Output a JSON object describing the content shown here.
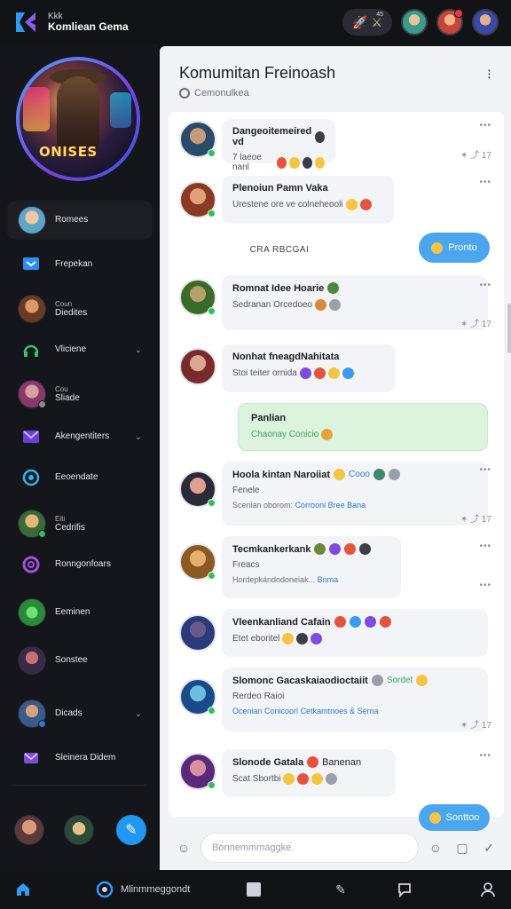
{
  "app": {
    "title_small": "Kkk",
    "title": "Komliean Gema"
  },
  "header": {
    "notif_count": "45"
  },
  "sidebar": {
    "hero_label": "ONISES",
    "items": [
      {
        "label": "Romees",
        "type": "avatar"
      },
      {
        "label": "Frepekan",
        "type": "icon"
      },
      {
        "small": "Coun",
        "label": "Diedites",
        "type": "avatar"
      },
      {
        "label": "Vliciene",
        "type": "icon",
        "chevron": true
      },
      {
        "small": "Cou",
        "label": "Sliade",
        "type": "avatar"
      },
      {
        "label": "Akengentiters",
        "type": "icon",
        "chevron": true
      },
      {
        "label": "Eeoendate",
        "type": "icon"
      },
      {
        "small": "Eiti",
        "label": "Cedrifis",
        "type": "avatar"
      },
      {
        "label": "Ronngonfoars",
        "type": "icon"
      },
      {
        "label": "Eeminen",
        "type": "avatar"
      },
      {
        "label": "Sonstee",
        "type": "avatar"
      },
      {
        "label": "Dicads",
        "type": "avatar",
        "chevron": true
      },
      {
        "label": "Sleinera Didem",
        "type": "icon"
      }
    ]
  },
  "panel": {
    "title": "Komumitan Freinoash",
    "subtitle": "Cemonulkea",
    "menu_icon": "⁝"
  },
  "messages": [
    {
      "title": "Dangeoitemeired vd",
      "text": "7 laeoe nanl",
      "reacts": "✶ ⤴ 17"
    },
    {
      "title": "Plenoiun Pamn Vaka",
      "text": "Urestene ore ve colneheooli",
      "reacts": ""
    },
    {
      "system": "CRA RBCGAI"
    },
    {
      "button": "Pronto"
    },
    {
      "title": "Romnat Idee Hoarie",
      "text": "Sedranan Orcedoeo",
      "reacts": "✶ ⤴ 17"
    },
    {
      "title": "Nonhat fneagdNahitata",
      "text": "Stoi teiter ornida",
      "reacts": ""
    },
    {
      "green_title": "Panlian",
      "green_text": "Chaonay Conicio"
    },
    {
      "title": "Hoola kintan Naroiiat",
      "title_link": "Cooo",
      "line2": "Fenele",
      "meta": "Scenian oborom:",
      "meta_link": "Corrooni Bree Bana",
      "reacts": "✶ ⤴ 17"
    },
    {
      "title": "Tecmkankerkank",
      "line2": "Freacs",
      "meta": "Hordepkándodoneiak...",
      "meta_link": "Bnma",
      "reacts": ""
    },
    {
      "title": "Vleenkanliand Cafain",
      "text": "Etet eboritel",
      "reacts": ""
    },
    {
      "title": "Slomonc Gacaskaiaodioctaiit",
      "title_link": "Sordet",
      "line2": "Rerdeo Raioi",
      "meta": "Ocenian Conicoorl",
      "meta_link": "Cetkamtnoes & Serna",
      "reacts": "✶ ⤴ 17"
    },
    {
      "title": "Slonode Gatala",
      "title_link": "Banenan",
      "text": "Scat Sbortbi",
      "reacts": ""
    },
    {
      "button": "Sonttoo"
    }
  ],
  "composer": {
    "placeholder": "Bonnemmmaggke."
  },
  "bottom": {
    "home": "home-icon",
    "center_label": "Mlinmmeggondt"
  },
  "colors": {
    "accent": "#2196f3",
    "bg": "#121317",
    "panel": "#f2f3f6",
    "online": "#2fbf5b"
  }
}
